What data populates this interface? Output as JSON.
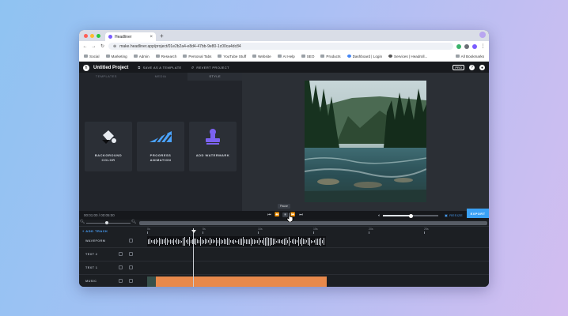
{
  "browser": {
    "tab_title": "Headliner",
    "tab_close": "×",
    "new_tab": "+",
    "url": "make.headliner.app/project/01e2b2a4-e8d4-47bb-9e80-1c00ca4dc84",
    "bookmarks": [
      "Social",
      "Marketing",
      "Admin",
      "Research",
      "Personal Tabs",
      "YouTube Stuff",
      "Website",
      "AI Help",
      "SEO",
      "Products",
      "Dashboard | Login",
      "Services | Headroll..."
    ],
    "all_bookmarks": "All Bookmarks"
  },
  "app": {
    "project_title": "Untitled Project",
    "save_template": "SAVE AS A TEMPLATE",
    "revert_project": "REVERT PROJECT",
    "pro_badge": "PRO",
    "help": "?",
    "panel_tabs": [
      "TEMPLATES",
      "MEDIA",
      "STYLE"
    ],
    "tools": [
      {
        "label": "BACKGROUND COLOR",
        "icon": "paint-bucket-icon"
      },
      {
        "label": "PROGRESS ANIMATION",
        "icon": "progress-bar-icon"
      },
      {
        "label": "ADD WATERMARK",
        "icon": "stamp-icon"
      }
    ]
  },
  "player": {
    "time": "00:01:00 / 00:05:00",
    "tooltip": "Pause",
    "buttons": [
      "⏮",
      "⏪",
      "⏸",
      "⏩",
      "⏭"
    ],
    "volume_level": 0.5,
    "resize": "RESIZE",
    "export": "EXPORT"
  },
  "timeline": {
    "add_track": "+ ADD TRACK",
    "ruler_marks": [
      "0s",
      "5s",
      "10s",
      "15s",
      "20s",
      "25s"
    ],
    "tracks": [
      {
        "label": "WAVEFORM"
      },
      {
        "label": "TEXT 2"
      },
      {
        "label": "TEXT 1"
      },
      {
        "label": "MUSIC"
      }
    ]
  },
  "colors": {
    "accent": "#3aa0f5",
    "music_clip": "#e8894b",
    "app_bg": "#1f2227"
  }
}
